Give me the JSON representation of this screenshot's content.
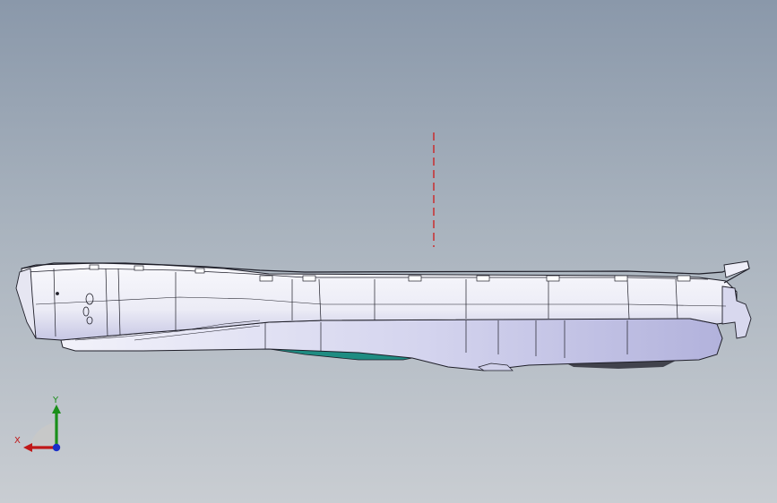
{
  "viewport": {
    "background_top": "#8a98aa",
    "background_bottom": "#c9cdd2"
  },
  "model": {
    "body_color": "#f6f6fb",
    "shade_color": "#c8c8e6",
    "edge_color": "#1e1e28",
    "underside_accent_color": "#1e8c82"
  },
  "center_line": {
    "color": "#d01a1a"
  },
  "triad": {
    "x_label": "X",
    "y_label": "Y",
    "x_color": "#c01818",
    "y_color": "#1a8f1a",
    "z_color": "#1a2fc8"
  }
}
